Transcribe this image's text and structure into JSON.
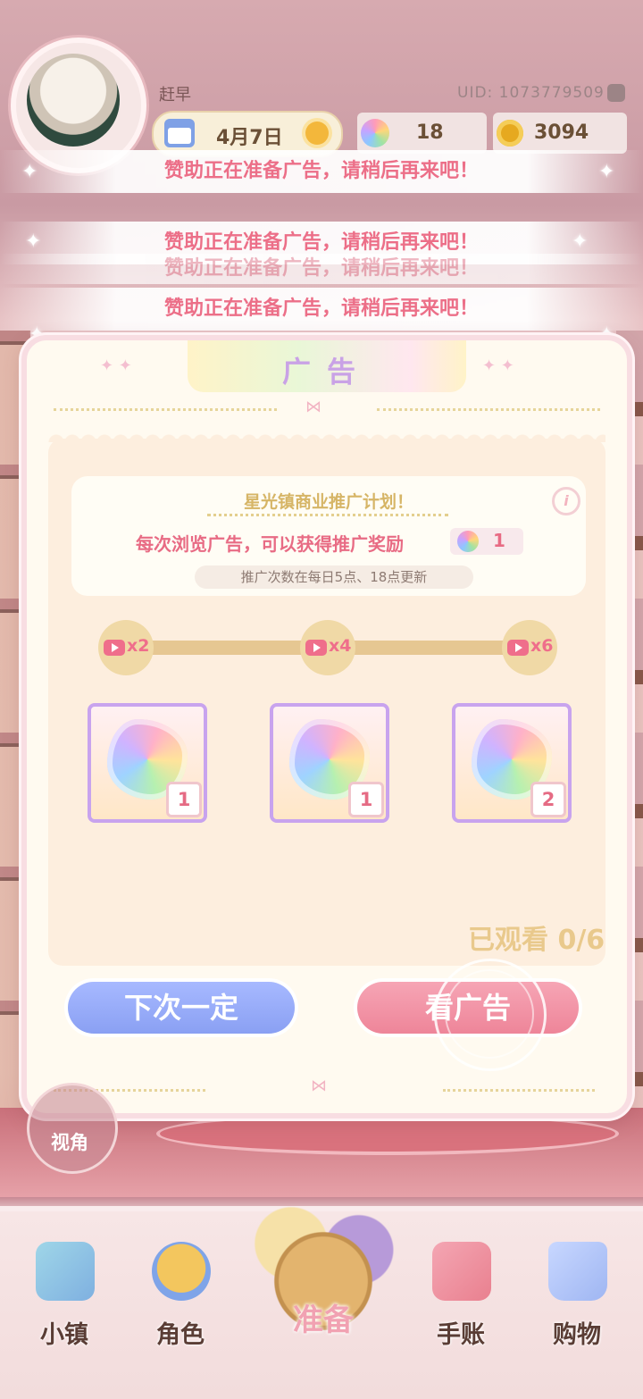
{
  "hud": {
    "player_name": "赶早",
    "uid": "UID: 1073779509",
    "date": "4月7日",
    "gems": "18",
    "coins": "3094"
  },
  "toasts": [
    "赞助正在准备广告，请稍后再来吧！",
    "赞助正在准备广告，请稍后再来吧！",
    "赞助正在准备广告，请稍后再来吧！",
    "赞助正在准备广告，请稍后再来吧！"
  ],
  "modal": {
    "title": "广告",
    "plan_title": "星光镇商业推广计划！",
    "reward_text": "每次浏览广告，可以获得推广奖励",
    "reward_count": "1",
    "refresh_note": "推广次数在每日5点、18点更新",
    "milestones": [
      {
        "label": "x2",
        "reward_qty": "1"
      },
      {
        "label": "x4",
        "reward_qty": "1"
      },
      {
        "label": "x6",
        "reward_qty": "2"
      }
    ],
    "watched": "已观看 0/6",
    "skip_button": "下次一定",
    "watch_button": "看广告"
  },
  "view_button": "视角",
  "nav": {
    "town": "小镇",
    "character": "角色",
    "prepare": "准备",
    "journal": "手账",
    "shop": "购物"
  },
  "colors": {
    "accent_pink": "#ec6f88",
    "skip_blue": "#8aa0f3",
    "watch_pink": "#ee8599",
    "gold": "#d6b566"
  }
}
